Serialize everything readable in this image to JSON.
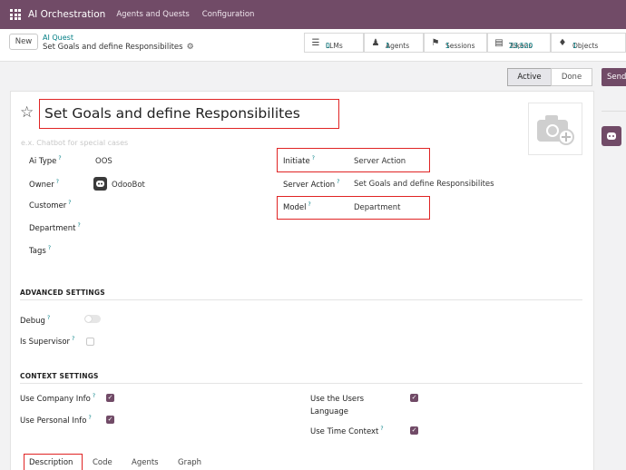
{
  "topbar": {
    "app_name": "AI Orchestration",
    "menus": [
      "Agents and Quests",
      "Configuration"
    ]
  },
  "controlbar": {
    "new_label": "New",
    "breadcrumb_parent": "AI Quest",
    "breadcrumb_current": "Set Goals and define Responsibilites",
    "stats": [
      {
        "icon": "database-icon",
        "label": "LLMs",
        "value": "0"
      },
      {
        "icon": "users-icon",
        "label": "Agents",
        "value": "1"
      },
      {
        "icon": "flag-icon",
        "label": "Sessions",
        "value": "1"
      },
      {
        "icon": "money-icon",
        "label": "Tokens",
        "value": "23,520"
      },
      {
        "icon": "puzzle-icon",
        "label": "Objects",
        "value": "1"
      }
    ]
  },
  "status": {
    "active_label": "Active",
    "done_label": "Done",
    "send_label": "Send"
  },
  "form": {
    "title": "Set Goals and define Responsibilites",
    "subtitle_placeholder": "e.x. Chatbot for special cases",
    "ai_type_label": "Ai Type",
    "ai_type_value": "OOS",
    "owner_label": "Owner",
    "owner_value": "OdooBot",
    "customer_label": "Customer",
    "department_label": "Department",
    "tags_label": "Tags",
    "initiate_label": "Initiate",
    "initiate_value": "Server Action",
    "server_action_label": "Server Action",
    "server_action_value": "Set Goals and define Responsibilites",
    "model_label": "Model",
    "model_value": "Department",
    "tooltip_mark": "?"
  },
  "advanced": {
    "heading": "ADVANCED SETTINGS",
    "debug_label": "Debug",
    "supervisor_label": "Is Supervisor"
  },
  "context": {
    "heading": "CONTEXT SETTINGS",
    "company_info_label": "Use Company Info",
    "personal_info_label": "Use Personal Info",
    "users_language_label_1": "Use the Users",
    "users_language_label_2": "Language",
    "time_context_label": "Use Time Context"
  },
  "tabs": [
    "Description",
    "Code",
    "Agents",
    "Graph"
  ],
  "colors": {
    "brand": "#714b67",
    "link": "#017e84",
    "highlight": "#e02424"
  }
}
